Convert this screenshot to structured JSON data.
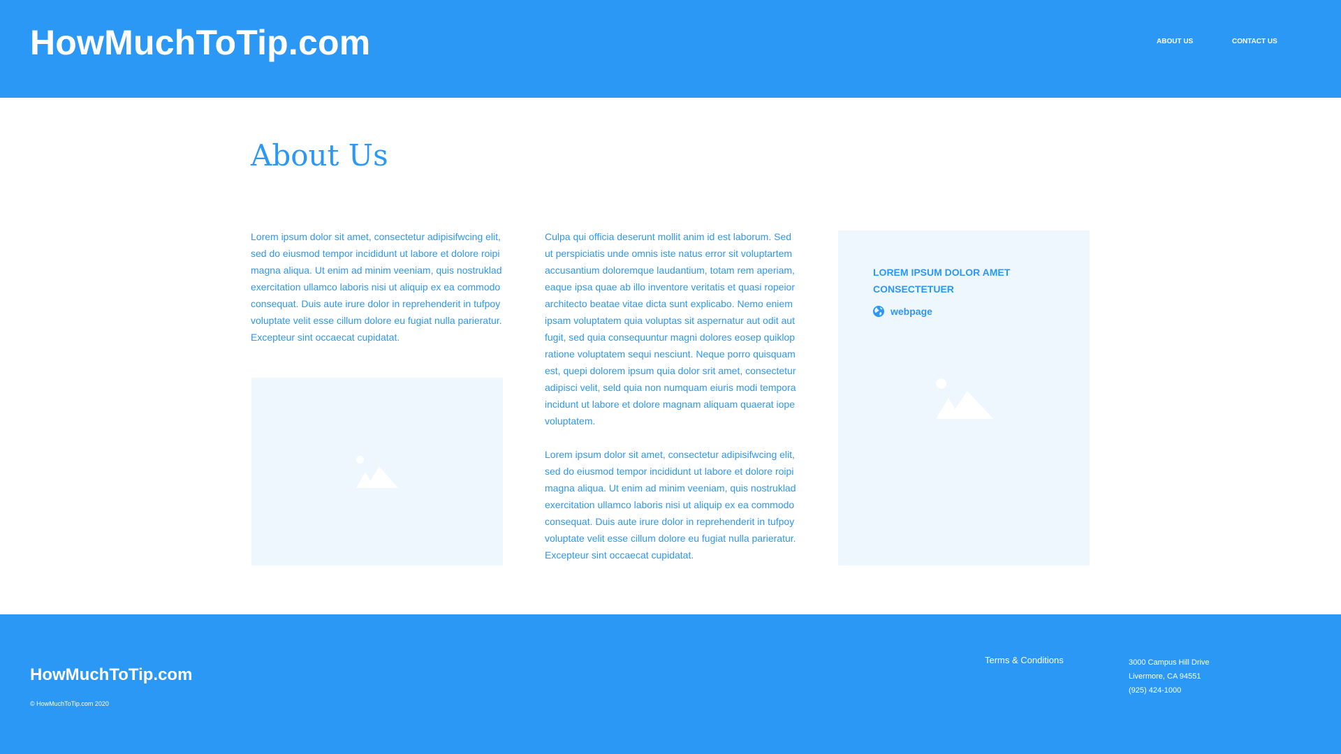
{
  "colors": {
    "brand": "#2B98F6",
    "panel": "#EEF6FE",
    "white": "#FFFFFF"
  },
  "header": {
    "brand": "HowMuchToTip.com",
    "nav": {
      "about": "ABOUT US",
      "contact": "CONTACT US"
    }
  },
  "main": {
    "title": "About Us",
    "col1_text": "Lorem ipsum dolor sit amet, consectetur adipisifwcing elit, sed do eiusmod tempor incididunt ut labore et dolore roipi magna aliqua. Ut enim ad minim veeniam, quis nostruklad exercitation ullamco laboris nisi ut aliquip ex ea commodo consequat. Duis aute irure dolor in reprehenderit in tufpoy voluptate velit esse cillum dolore eu fugiat nulla parieratur. Excepteur sint occaecat cupidatat.",
    "col2_text": "Culpa qui officia deserunt mollit anim id est laborum. Sed ut perspiciatis unde omnis iste natus error sit voluptartem accusantium doloremque laudantium, totam rem aperiam, eaque ipsa quae ab illo inventore veritatis et quasi ropeior architecto beatae vitae dicta sunt explicabo. Nemo eniem ipsam voluptatem quia voluptas sit aspernatur aut odit aut fugit, sed quia consequuntur magni dolores eosep quiklop ratione voluptatem sequi nesciunt. Neque porro quisquam est, quepi dolorem ipsum quia dolor srit amet, consectetur adipisci velit, seld quia non numquam eiuris modi tempora incidunt ut labore et dolore magnam aliquam quaerat iope voluptatem.",
    "col2b_text": "Lorem ipsum dolor sit amet, consectetur adipisifwcing elit, sed do eiusmod tempor incididunt ut labore et dolore roipi magna aliqua. Ut enim ad minim veeniam, quis nostruklad exercitation ullamco laboris nisi ut aliquip ex ea commodo consequat. Duis aute irure dolor in reprehenderit in tufpoy voluptate velit esse cillum dolore eu fugiat nulla parieratur. Excepteur sint occaecat cupidatat.",
    "card": {
      "title": "LOREM IPSUM DOLOR AMET CONSECTETUER",
      "link_label": "webpage",
      "link_icon": "globe-icon",
      "image_icon": "image-placeholder-icon"
    },
    "image_icon": "image-placeholder-icon"
  },
  "footer": {
    "brand": "HowMuchToTip.com",
    "copyright": "© HowMuchToTip.com 2020",
    "terms": "Terms & Conditions",
    "address": {
      "line1": "3000 Campus Hill Drive",
      "line2": "Livermore, CA 94551",
      "phone": "(925) 424-1000"
    }
  }
}
